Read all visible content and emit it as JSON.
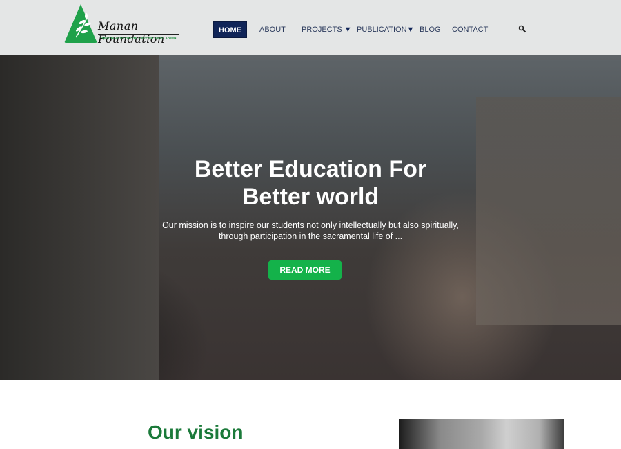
{
  "brand": {
    "name": "Manan Foundation",
    "tagline": "THINK TANK TO CREATE A BETTER BANGLADESH",
    "color": "#1fa14a"
  },
  "nav": {
    "items": [
      {
        "label": "HOME",
        "active": true
      },
      {
        "label": "ABOUT"
      },
      {
        "label": "PROJECTS",
        "dropdown": true
      },
      {
        "label": "PUBLICATION",
        "dropdown": true
      },
      {
        "label": "BLOG"
      },
      {
        "label": "CONTACT"
      }
    ],
    "caret": "▼",
    "search_icon": "🔍"
  },
  "hero": {
    "title_line1": "Better Education For",
    "title_line2": "Better world",
    "subtitle_line1": "Our mission is to inspire our students not only intellectually but also spiritually,",
    "subtitle_line2": "through participation in the sacramental life of ...",
    "button": "READ MORE"
  },
  "vision": {
    "title": "Our vision"
  }
}
